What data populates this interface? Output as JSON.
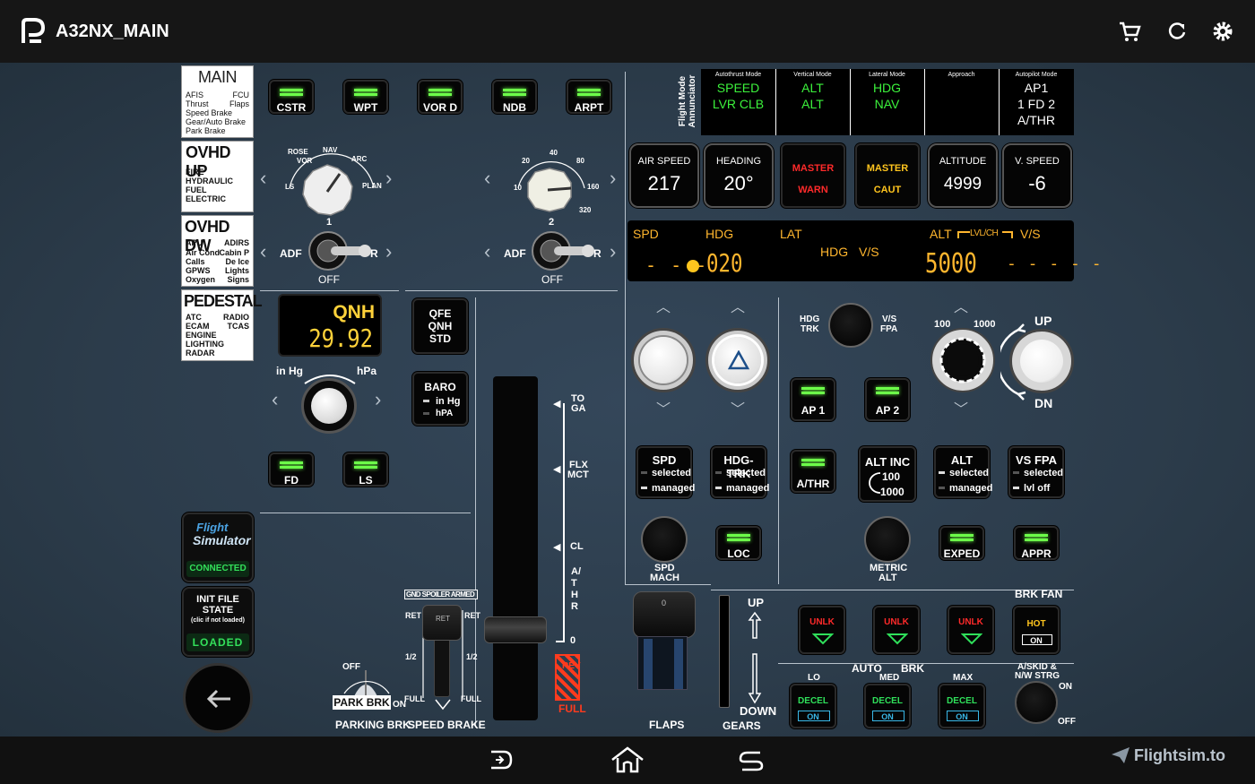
{
  "app": {
    "title": "A32NX_MAIN",
    "logo": "flight-app-logo-icon",
    "actions": [
      "cart-icon",
      "refresh-icon",
      "settings-icon"
    ]
  },
  "menus": {
    "main": {
      "title": "MAIN",
      "items": [
        "AFIS",
        "FCU",
        "Thrust",
        "Flaps",
        "Speed Brake",
        "Gear/Auto Brake",
        "Park Brake"
      ]
    },
    "ovhd_up": {
      "title": "OVHD UP",
      "items": [
        "FIRE",
        "HYDRAULIC",
        "FUEL",
        "ELECTRIC"
      ]
    },
    "ovhd_dw": {
      "title": "OVHD DW",
      "items": [
        "APU",
        "ADIRS",
        "Air Cond",
        "Cabin P",
        "Calls",
        "De Ice",
        "GPWS",
        "Lights",
        "Oxygen",
        "Signs"
      ]
    },
    "pedestal": {
      "title": "PEDESTAL",
      "items": [
        "ATC",
        "RADIO",
        "ECAM",
        "TCAS",
        "ENGINE",
        "LIGHTING",
        "RADAR"
      ]
    }
  },
  "efis_buttons": [
    "CSTR",
    "WPT",
    "VOR D",
    "NDB",
    "ARPT"
  ],
  "nd_mode": {
    "labels": [
      "ROSE",
      "VOR",
      "NAV",
      "ARC",
      "LS",
      "PLAN"
    ]
  },
  "nd_range": {
    "labels": [
      "20",
      "40",
      "80",
      "10",
      "160",
      "320"
    ]
  },
  "adf": {
    "left": {
      "num": "1",
      "adf": "ADF",
      "r": "R",
      "off": "OFF"
    },
    "right": {
      "num": "2",
      "adf": "ADF",
      "r": "R",
      "off": "OFF"
    }
  },
  "qnh": {
    "label": "QNH",
    "value": "29.92",
    "inhg": "in Hg",
    "hpa": "hPa"
  },
  "qfe": {
    "l1": "QFE",
    "l2": "QNH",
    "l3": "STD"
  },
  "baro": {
    "title": "BARO",
    "o1": "in Hg",
    "o2": "hPA"
  },
  "fd_ls": [
    "FD",
    "LS"
  ],
  "sim": {
    "logo1": "Flight",
    "logo2": "Simulator",
    "status": "CONNECTED"
  },
  "init": {
    "l1": "INIT FILE",
    "l2": "STATE",
    "l3": "(clic if not loaded)",
    "status": "LOADED"
  },
  "thrust": {
    "detents": [
      "TO",
      "GA",
      "FLX",
      "MCT",
      "CL",
      "0"
    ],
    "athr": "A/THR",
    "rev": "REV",
    "full": "FULL"
  },
  "speedbrake": {
    "armed": "GND SPOILER ARMED",
    "ret": "RET",
    "half": "1/2",
    "full": "FULL",
    "label": "SPEED BRAKE"
  },
  "parkbrk": {
    "off": "OFF",
    "on": "ON",
    "lbl": "PARK BRK",
    "label": "PARKING BRK"
  },
  "fma": {
    "side": "Flight Mode Annunciator",
    "cols": [
      {
        "h": "Autothrust Mode",
        "l1": "SPEED",
        "l2": "LVR CLB",
        "color": "#3cf23c"
      },
      {
        "h": "Vertical Mode",
        "l1": "ALT",
        "l2": "ALT",
        "color": "#3cf23c"
      },
      {
        "h": "Lateral Mode",
        "l1": "HDG",
        "l2": "NAV",
        "color": "#3cf23c"
      },
      {
        "h": "Approach",
        "l1": "",
        "l2": "",
        "color": "#3cf23c"
      },
      {
        "h": "Autopilot Mode",
        "l1": "AP1",
        "l2": "1 FD 2",
        "l3": "A/THR",
        "color": "#ffffff"
      }
    ]
  },
  "indicators": [
    {
      "label": "AIR SPEED",
      "value": "217"
    },
    {
      "label": "HEADING",
      "value": "20°"
    },
    {
      "label": "ALTITUDE",
      "value": "4999"
    },
    {
      "label": "V. SPEED",
      "value": "-6"
    }
  ],
  "master": {
    "warn1": "MASTER",
    "warn2": "WARN",
    "caut1": "MASTER",
    "caut2": "CAUT"
  },
  "fcu": {
    "spd": "SPD",
    "hdg": "HDG",
    "lat": "LAT",
    "spd_val": "- - -",
    "hdg_val": "020",
    "hdgvs": "HDG",
    "vs_lbl": "V/S",
    "alt": "ALT",
    "lvlch": "LVL/CH",
    "vs": "V/S",
    "alt_val": "5000",
    "vs_val": "- - - - -"
  },
  "hdgtrk": {
    "l1": "HDG",
    "l2": "TRK",
    "r1": "V/S",
    "r2": "FPA"
  },
  "altscale": {
    "a": "100",
    "b": "1000",
    "up": "UP",
    "dn": "DN"
  },
  "ap": [
    "AP 1",
    "AP 2"
  ],
  "modes": [
    {
      "title": "SPD",
      "o1": "selected",
      "o2": "managed"
    },
    {
      "title": "HDG-TRK",
      "o1": "selected",
      "o2": "managed"
    },
    {
      "title": "ALT",
      "o1": "selected",
      "o2": "managed"
    },
    {
      "title": "VS FPA",
      "o1": "selected",
      "o2": "lvl off"
    }
  ],
  "altinc": {
    "title": "ALT INC",
    "a": "100",
    "b": "1000"
  },
  "athr": "A/THR",
  "small_btns": [
    "LOC",
    "EXPED",
    "APPR"
  ],
  "knob_lbls": {
    "spdmach1": "SPD",
    "spdmach2": "MACH",
    "metric1": "METRIC",
    "metric2": "ALT"
  },
  "flaps": {
    "label": "FLAPS",
    "pos": "0"
  },
  "gear": {
    "up": "UP",
    "down": "DOWN",
    "label": "GEARS"
  },
  "unlk": [
    "UNLK",
    "UNLK",
    "UNLK"
  ],
  "brkfan": {
    "title": "BRK FAN",
    "hot": "HOT",
    "on": "ON"
  },
  "autobrk": {
    "title": "AUTO",
    "brk": "BRK",
    "lo": "LO",
    "med": "MED",
    "max": "MAX",
    "decel": "DECEL",
    "on": "ON"
  },
  "antiskid": {
    "l1": "A/SKID &",
    "l2": "N/W STRG",
    "on": "ON",
    "off": "OFF"
  },
  "watermark": "Flightsim.to"
}
